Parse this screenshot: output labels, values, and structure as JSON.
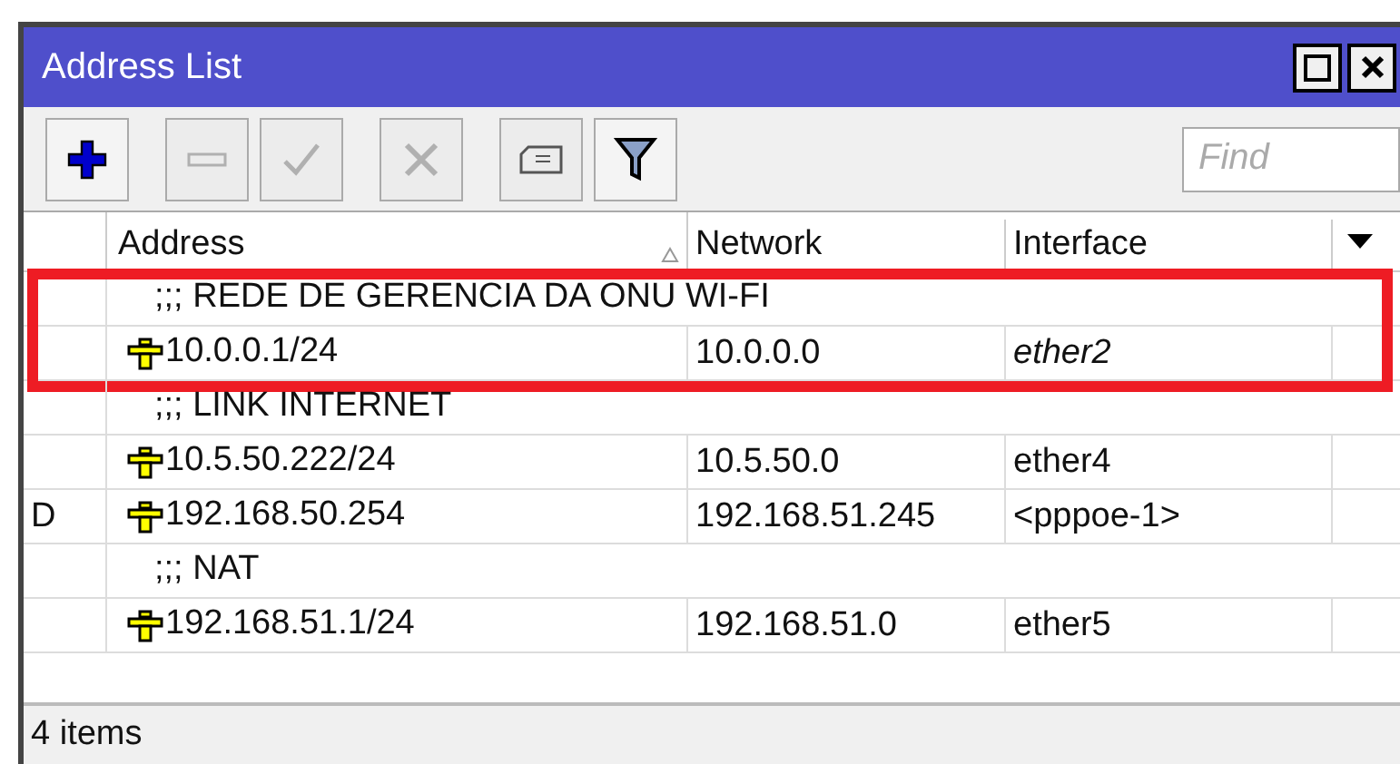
{
  "window": {
    "title": "Address List"
  },
  "toolbar": [
    {
      "kind": "add",
      "disabled": false
    },
    {
      "kind": "remove",
      "disabled": true
    },
    {
      "kind": "enable",
      "disabled": true
    },
    {
      "kind": "disable",
      "disabled": true
    },
    {
      "kind": "comment",
      "disabled": true
    },
    {
      "kind": "filter",
      "disabled": false
    }
  ],
  "search": {
    "placeholder": "Find"
  },
  "table": {
    "columns": [
      "Address",
      "Network",
      "Interface"
    ],
    "rows": [
      {
        "kind": "comment",
        "text": ";;; REDE DE GERENCIA DA ONU WI-FI",
        "highlighted": true
      },
      {
        "kind": "address",
        "flag": "",
        "address": "10.0.0.1/24",
        "network": "10.0.0.0",
        "interface": "ether2",
        "italic": true,
        "highlighted": true
      },
      {
        "kind": "comment",
        "text": ";;; LINK INTERNET",
        "highlighted": false
      },
      {
        "kind": "address",
        "flag": "",
        "address": "10.5.50.222/24",
        "network": "10.5.50.0",
        "interface": "ether4",
        "italic": false,
        "highlighted": false
      },
      {
        "kind": "address",
        "flag": "D",
        "address": "192.168.50.254",
        "network": "192.168.51.245",
        "interface": "<pppoe-1>",
        "italic": false,
        "highlighted": false
      },
      {
        "kind": "comment",
        "text": ";;; NAT",
        "highlighted": false
      },
      {
        "kind": "address",
        "flag": "",
        "address": "192.168.51.1/24",
        "network": "192.168.51.0",
        "interface": "ether5",
        "italic": false,
        "highlighted": false
      }
    ]
  },
  "status_bar": {
    "text": "4 items"
  }
}
